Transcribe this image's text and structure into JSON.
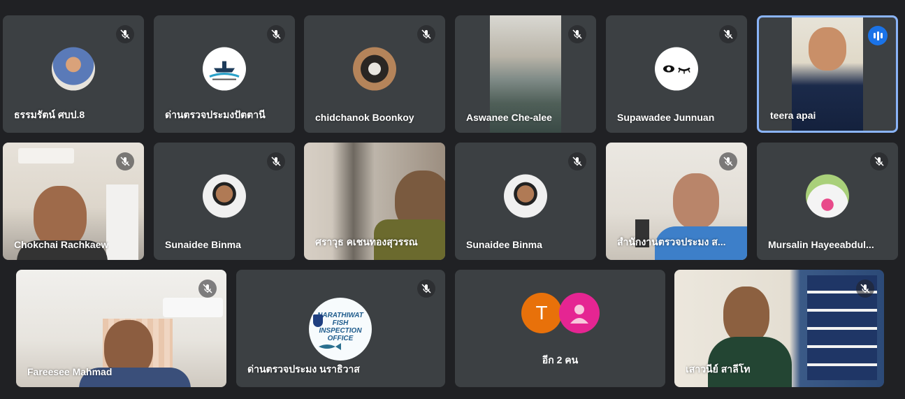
{
  "participants": [
    {
      "name": "ธรรมรัตน์ ศบป.8",
      "muted": true,
      "kind": "avatar",
      "avatar": "person-photo"
    },
    {
      "name": "ด่านตรวจประมงปัตตานี",
      "muted": true,
      "kind": "avatar",
      "avatar": "boat-logo"
    },
    {
      "name": "chidchanok Boonkoy",
      "muted": true,
      "kind": "avatar",
      "avatar": "coffee-photo"
    },
    {
      "name": "Aswanee Che-alee",
      "muted": true,
      "kind": "video",
      "avatar": "landscape"
    },
    {
      "name": "Supawadee Junnuan",
      "muted": true,
      "kind": "avatar",
      "avatar": "eye-logo"
    },
    {
      "name": "teera apai",
      "muted": false,
      "speaking": true,
      "kind": "video",
      "avatar": "person-video"
    },
    {
      "name": "Chokchai Rachkaew",
      "muted": true,
      "kind": "video",
      "avatar": "person-video"
    },
    {
      "name": "Sunaidee Binma",
      "muted": true,
      "kind": "avatar",
      "avatar": "person-photo"
    },
    {
      "name": "ศราวุธ คเชนทองสุวรรณ",
      "muted": false,
      "kind": "video",
      "avatar": "person-video"
    },
    {
      "name": "Sunaidee Binma",
      "muted": true,
      "kind": "avatar",
      "avatar": "person-photo"
    },
    {
      "name": "สำนักงานตรวจประมง ส...",
      "muted": true,
      "kind": "video",
      "avatar": "person-video"
    },
    {
      "name": "Mursalin Hayeeabdul...",
      "muted": true,
      "kind": "avatar",
      "avatar": "cat-photo"
    },
    {
      "name": "Fareesee Mahmad",
      "muted": true,
      "kind": "video",
      "avatar": "person-video"
    },
    {
      "name": "ด่านตรวจประมง นราธิวาส",
      "muted": true,
      "kind": "avatar",
      "avatar": "fish-office-logo"
    },
    {
      "name": "อีก 2 คน",
      "muted": false,
      "kind": "others",
      "initial": "T"
    },
    {
      "name": "เสาวนีย์ สาลีโท",
      "muted": true,
      "kind": "video",
      "avatar": "person-video"
    }
  ],
  "logo": {
    "narathiwat_line1": "NARATHIWAT",
    "narathiwat_line2": "FISH",
    "narathiwat_line3": "INSPECTION",
    "narathiwat_line4": "OFFICE"
  },
  "colors": {
    "tile": "#3c4043",
    "background": "#202124",
    "speaking_border": "#8ab4f8",
    "initial_orange": "#e8710a",
    "initial_pink": "#e52592"
  }
}
